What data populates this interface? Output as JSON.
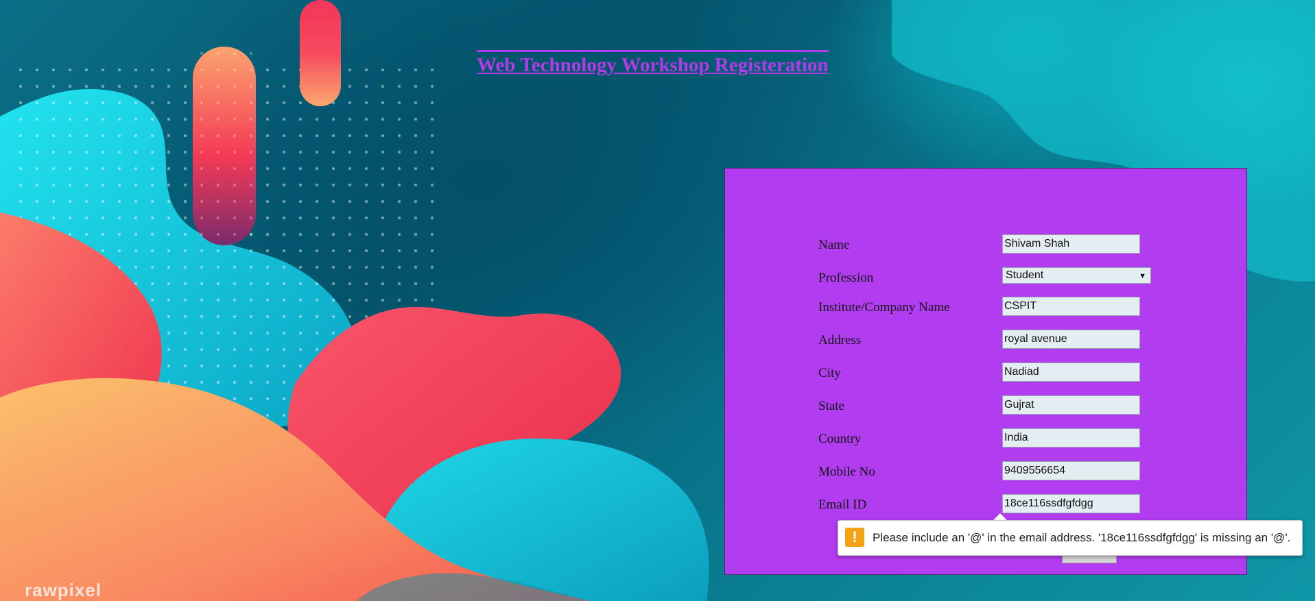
{
  "page": {
    "title": "Web Technology Workshop Registeration",
    "watermark": "rawpixel"
  },
  "form": {
    "fields": [
      {
        "label": "Name",
        "value": "Shivam Shah"
      },
      {
        "label": "Profession",
        "value": "Student"
      },
      {
        "label": "Institute/Company Name",
        "value": "CSPIT"
      },
      {
        "label": "Address",
        "value": "royal avenue"
      },
      {
        "label": "City",
        "value": "Nadiad"
      },
      {
        "label": "State",
        "value": "Gujrat"
      },
      {
        "label": "Country",
        "value": "India"
      },
      {
        "label": "Mobile No",
        "value": "9409556654"
      },
      {
        "label": "Email ID",
        "value": "18ce116ssdfgfdgg"
      }
    ],
    "submit_label": ""
  },
  "validation": {
    "icon": "warning-icon",
    "icon_glyph": "!",
    "message": "Please include an '@' in the email address. '18ce116ssdfgfdgg' is missing an '@'."
  },
  "colors": {
    "panel": "#b23cf0",
    "title": "#b23be8",
    "warning": "#f5a314"
  }
}
